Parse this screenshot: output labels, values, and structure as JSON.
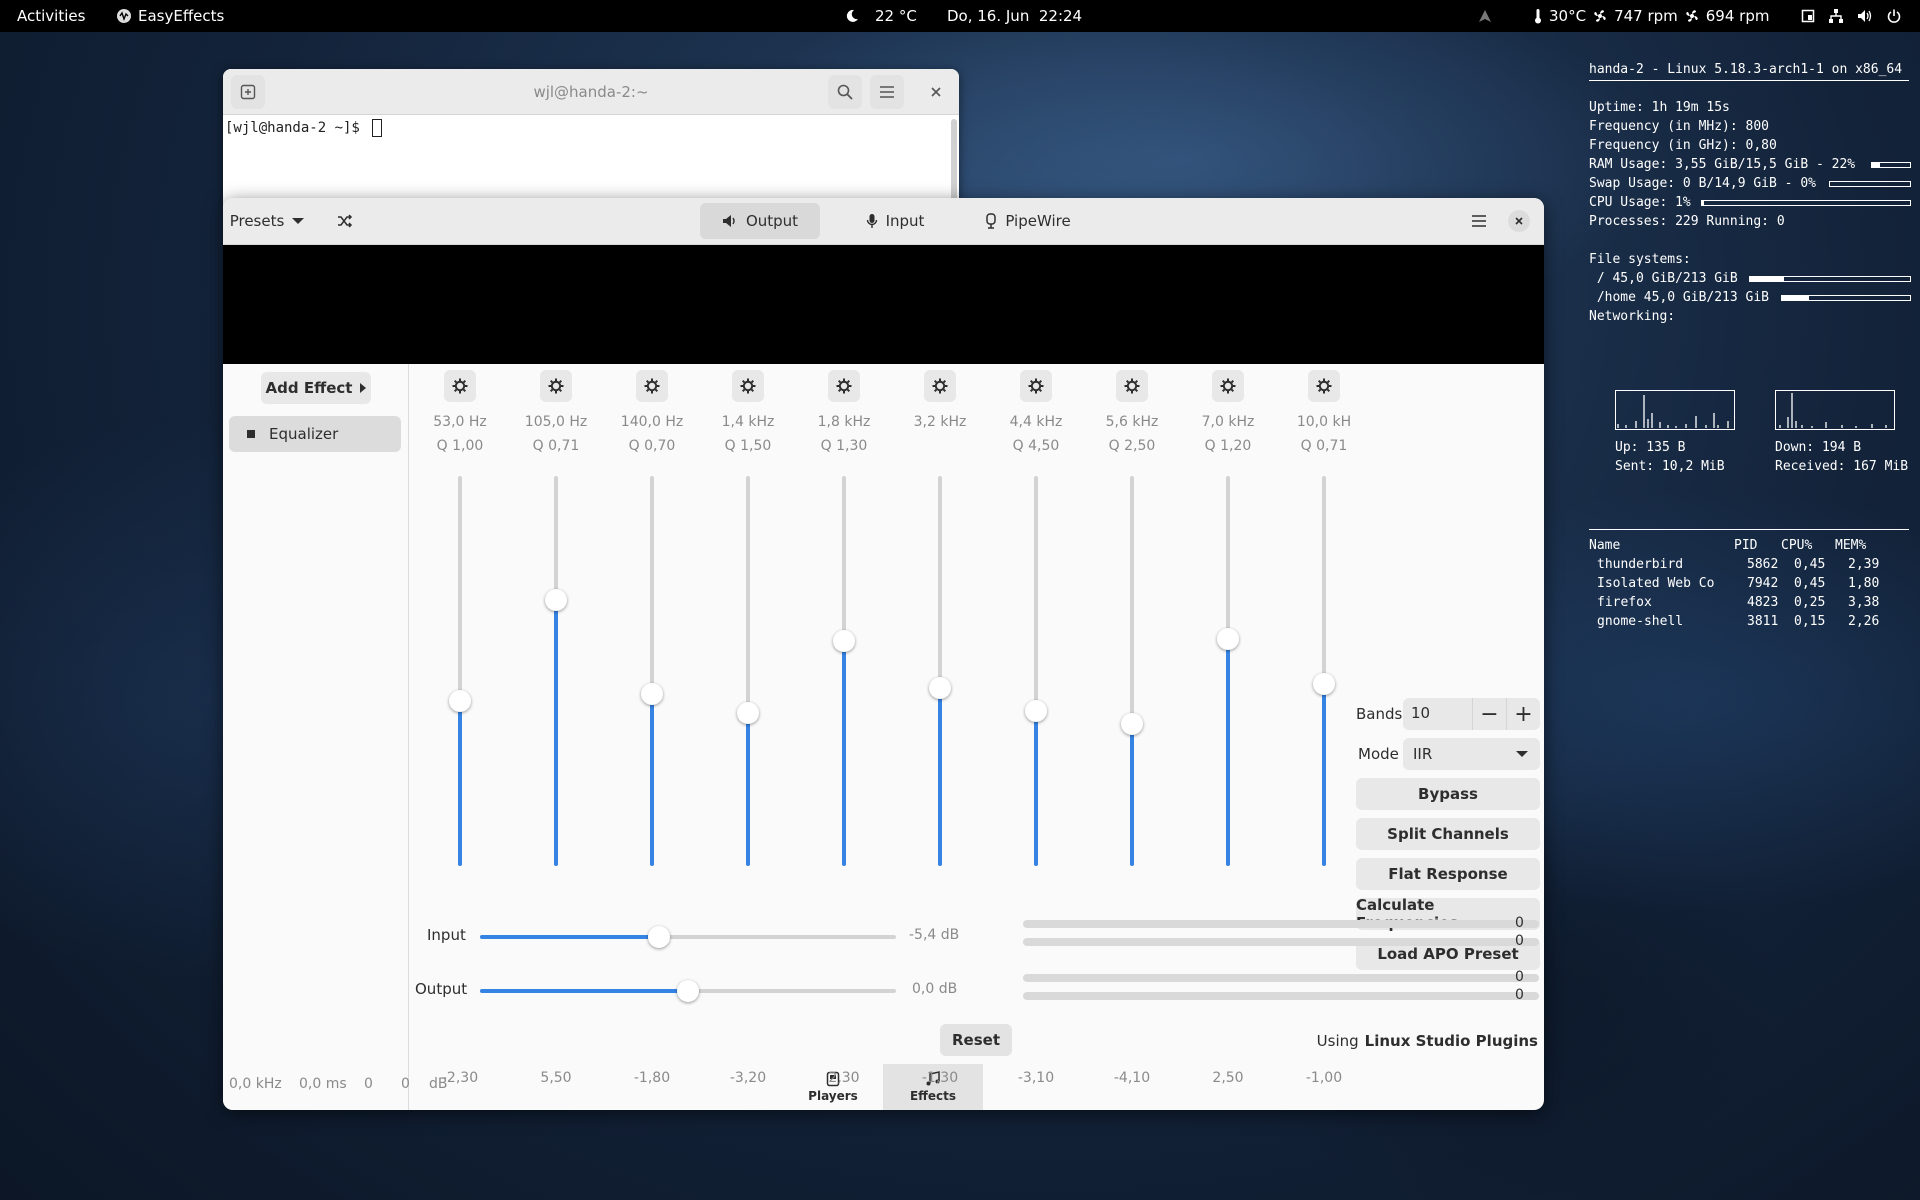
{
  "topbar": {
    "activities": "Activities",
    "app_name": "EasyEffects",
    "weather": "22 °C",
    "clock": "Do, 16. Jun  22:24",
    "temp": "30°C",
    "fan1": "747 rpm",
    "fan2": "694 rpm"
  },
  "terminal": {
    "title": "wjl@handa-2:~",
    "prompt": "[wjl@handa-2 ~]$ "
  },
  "easyeffects": {
    "presets_label": "Presets",
    "tabs": [
      {
        "label": "Output",
        "icon": "speaker-icon"
      },
      {
        "label": "Input",
        "icon": "microphone-icon"
      },
      {
        "label": "PipeWire",
        "icon": "pipewire-icon"
      }
    ],
    "add_effect_label": "Add Effect",
    "effects": [
      {
        "label": "Equalizer"
      }
    ],
    "bands": [
      {
        "freq": "53,0 Hz",
        "q": "Q 1,00",
        "gain": "-2,30",
        "gain_value": -2.3
      },
      {
        "freq": "105,0 Hz",
        "q": "Q 0,71",
        "gain": "5,50",
        "gain_value": 5.5
      },
      {
        "freq": "140,0 Hz",
        "q": "Q 0,70",
        "gain": "-1,80",
        "gain_value": -1.8
      },
      {
        "freq": "1,4 kHz",
        "q": "Q 1,50",
        "gain": "-3,20",
        "gain_value": -3.2
      },
      {
        "freq": "1,8 kHz",
        "q": "Q 1,30",
        "gain": "2,30",
        "gain_value": 2.3
      },
      {
        "freq": "3,2 kHz",
        "q": "",
        "gain": "-1,30",
        "gain_value": -1.3
      },
      {
        "freq": "4,4 kHz",
        "q": "Q 4,50",
        "gain": "-3,10",
        "gain_value": -3.1
      },
      {
        "freq": "5,6 kHz",
        "q": "Q 2,50",
        "gain": "-4,10",
        "gain_value": -4.1
      },
      {
        "freq": "7,0 kHz",
        "q": "Q 1,20",
        "gain": "2,50",
        "gain_value": 2.5
      },
      {
        "freq": "10,0 kH",
        "q": "Q 0,71",
        "gain": "-1,00",
        "gain_value": -1.0
      }
    ],
    "bands_label": "Bands",
    "bands_count": "10",
    "mode_label": "Mode",
    "mode_value": "IIR",
    "buttons": {
      "bypass": "Bypass",
      "split_channels": "Split Channels",
      "flat_response": "Flat Response",
      "calculate_frequencies": "Calculate Frequencies",
      "load_apo_preset": "Load APO Preset"
    },
    "input": {
      "label": "Input",
      "db": "-5,4 dB",
      "level_fraction": 0.43,
      "meter_l": "0",
      "meter_r": "0"
    },
    "output": {
      "label": "Output",
      "db": "0,0 dB",
      "level_fraction": 0.5,
      "meter_l": "0",
      "meter_r": "0"
    },
    "reset_label": "Reset",
    "using_label": "Using",
    "using_value": "Linux Studio Plugins",
    "status": {
      "rate": "0,0 kHz",
      "latency": "0,0 ms",
      "val1": "0",
      "val2": "0",
      "unit": "dB"
    },
    "bottom_tabs": [
      {
        "label": "Players",
        "icon": "players-icon"
      },
      {
        "label": "Effects",
        "icon": "music-note-icon"
      }
    ],
    "accent_color": "#3584e4"
  },
  "conky": {
    "header": "handa-2 - Linux 5.18.3-arch1-1 on x86_64",
    "uptime": "Uptime: 1h 19m 15s",
    "freq_mhz": "Frequency (in MHz): 800",
    "freq_ghz": "Frequency (in GHz): 0,80",
    "ram": "RAM Usage: 3,55 GiB/15,5 GiB - 22%",
    "ram_fraction": 0.22,
    "swap": "Swap Usage: 0 B/14,9 GiB - 0%",
    "swap_fraction": 0.0,
    "cpu": "CPU Usage: 1%",
    "cpu_fraction": 0.01,
    "processes": "Processes: 229  Running: 0",
    "fs_title": "File systems:",
    "fs_root": " / 45,0 GiB/213 GiB",
    "fs_root_fraction": 0.21,
    "fs_home": " /home 45,0 GiB/213 GiB",
    "fs_home_fraction": 0.21,
    "net_title": "Networking:",
    "up": "Up: 135 B",
    "down": "Down: 194 B",
    "sent": "Sent: 10,2 MiB",
    "received": "Received: 167 MiB",
    "proc_headers": [
      "Name",
      "PID",
      "CPU%",
      "MEM%"
    ],
    "procs": [
      {
        "name": "thunderbird",
        "pid": "5862",
        "cpu": "0,45",
        "mem": "2,39"
      },
      {
        "name": "Isolated Web Co",
        "pid": "7942",
        "cpu": "0,45",
        "mem": "1,80"
      },
      {
        "name": "firefox",
        "pid": "4823",
        "cpu": "0,25",
        "mem": "3,38"
      },
      {
        "name": "gnome-shell",
        "pid": "3811",
        "cpu": "0,15",
        "mem": "2,26"
      }
    ]
  }
}
